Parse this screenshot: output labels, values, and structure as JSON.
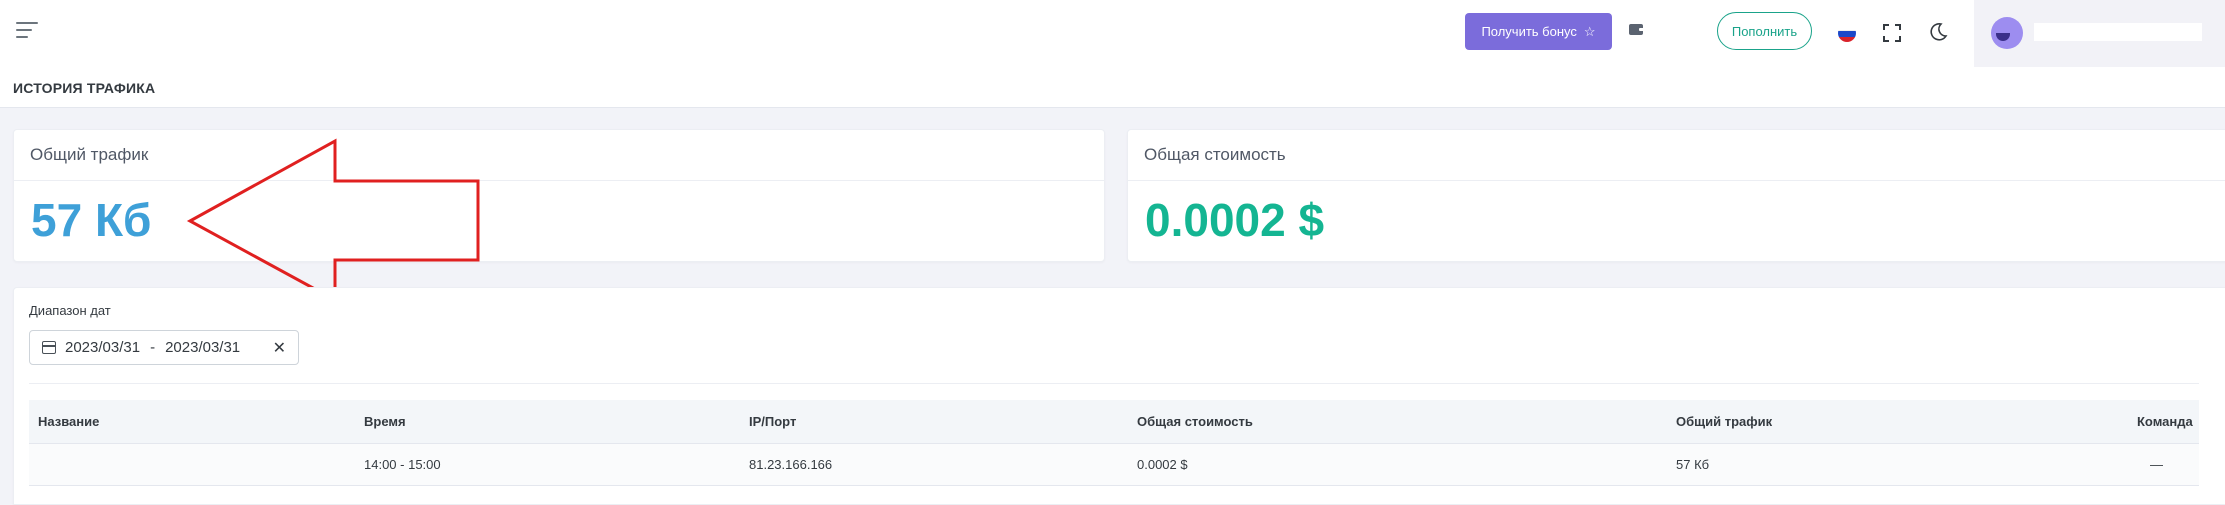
{
  "header": {
    "bonus_label": "Получить бонус",
    "topup_label": "Пополнить",
    "language_flag": "ru",
    "colors": {
      "bonus": "#7b6cdb",
      "topup": "#1aa38a"
    }
  },
  "page": {
    "title": "ИСТОРИЯ ТРАФИКА"
  },
  "stats": {
    "traffic": {
      "label": "Общий трафик",
      "value": "57 Кб",
      "color": "#3ea0d8"
    },
    "cost": {
      "label": "Общая стоимость",
      "value": "0.0002 $",
      "color": "#14b592"
    }
  },
  "filter": {
    "range_label": "Диапазон дат",
    "date_from": "2023/03/31",
    "date_sep": "-",
    "date_to": "2023/03/31"
  },
  "table": {
    "columns": [
      "Название",
      "Время",
      "IP/Порт",
      "Общая стоимость",
      "Общий трафик",
      "Команда"
    ],
    "rows": [
      [
        "",
        "14:00 - 15:00",
        "81.23.166.166",
        "0.0002 $",
        "57 Кб",
        "—"
      ]
    ]
  }
}
